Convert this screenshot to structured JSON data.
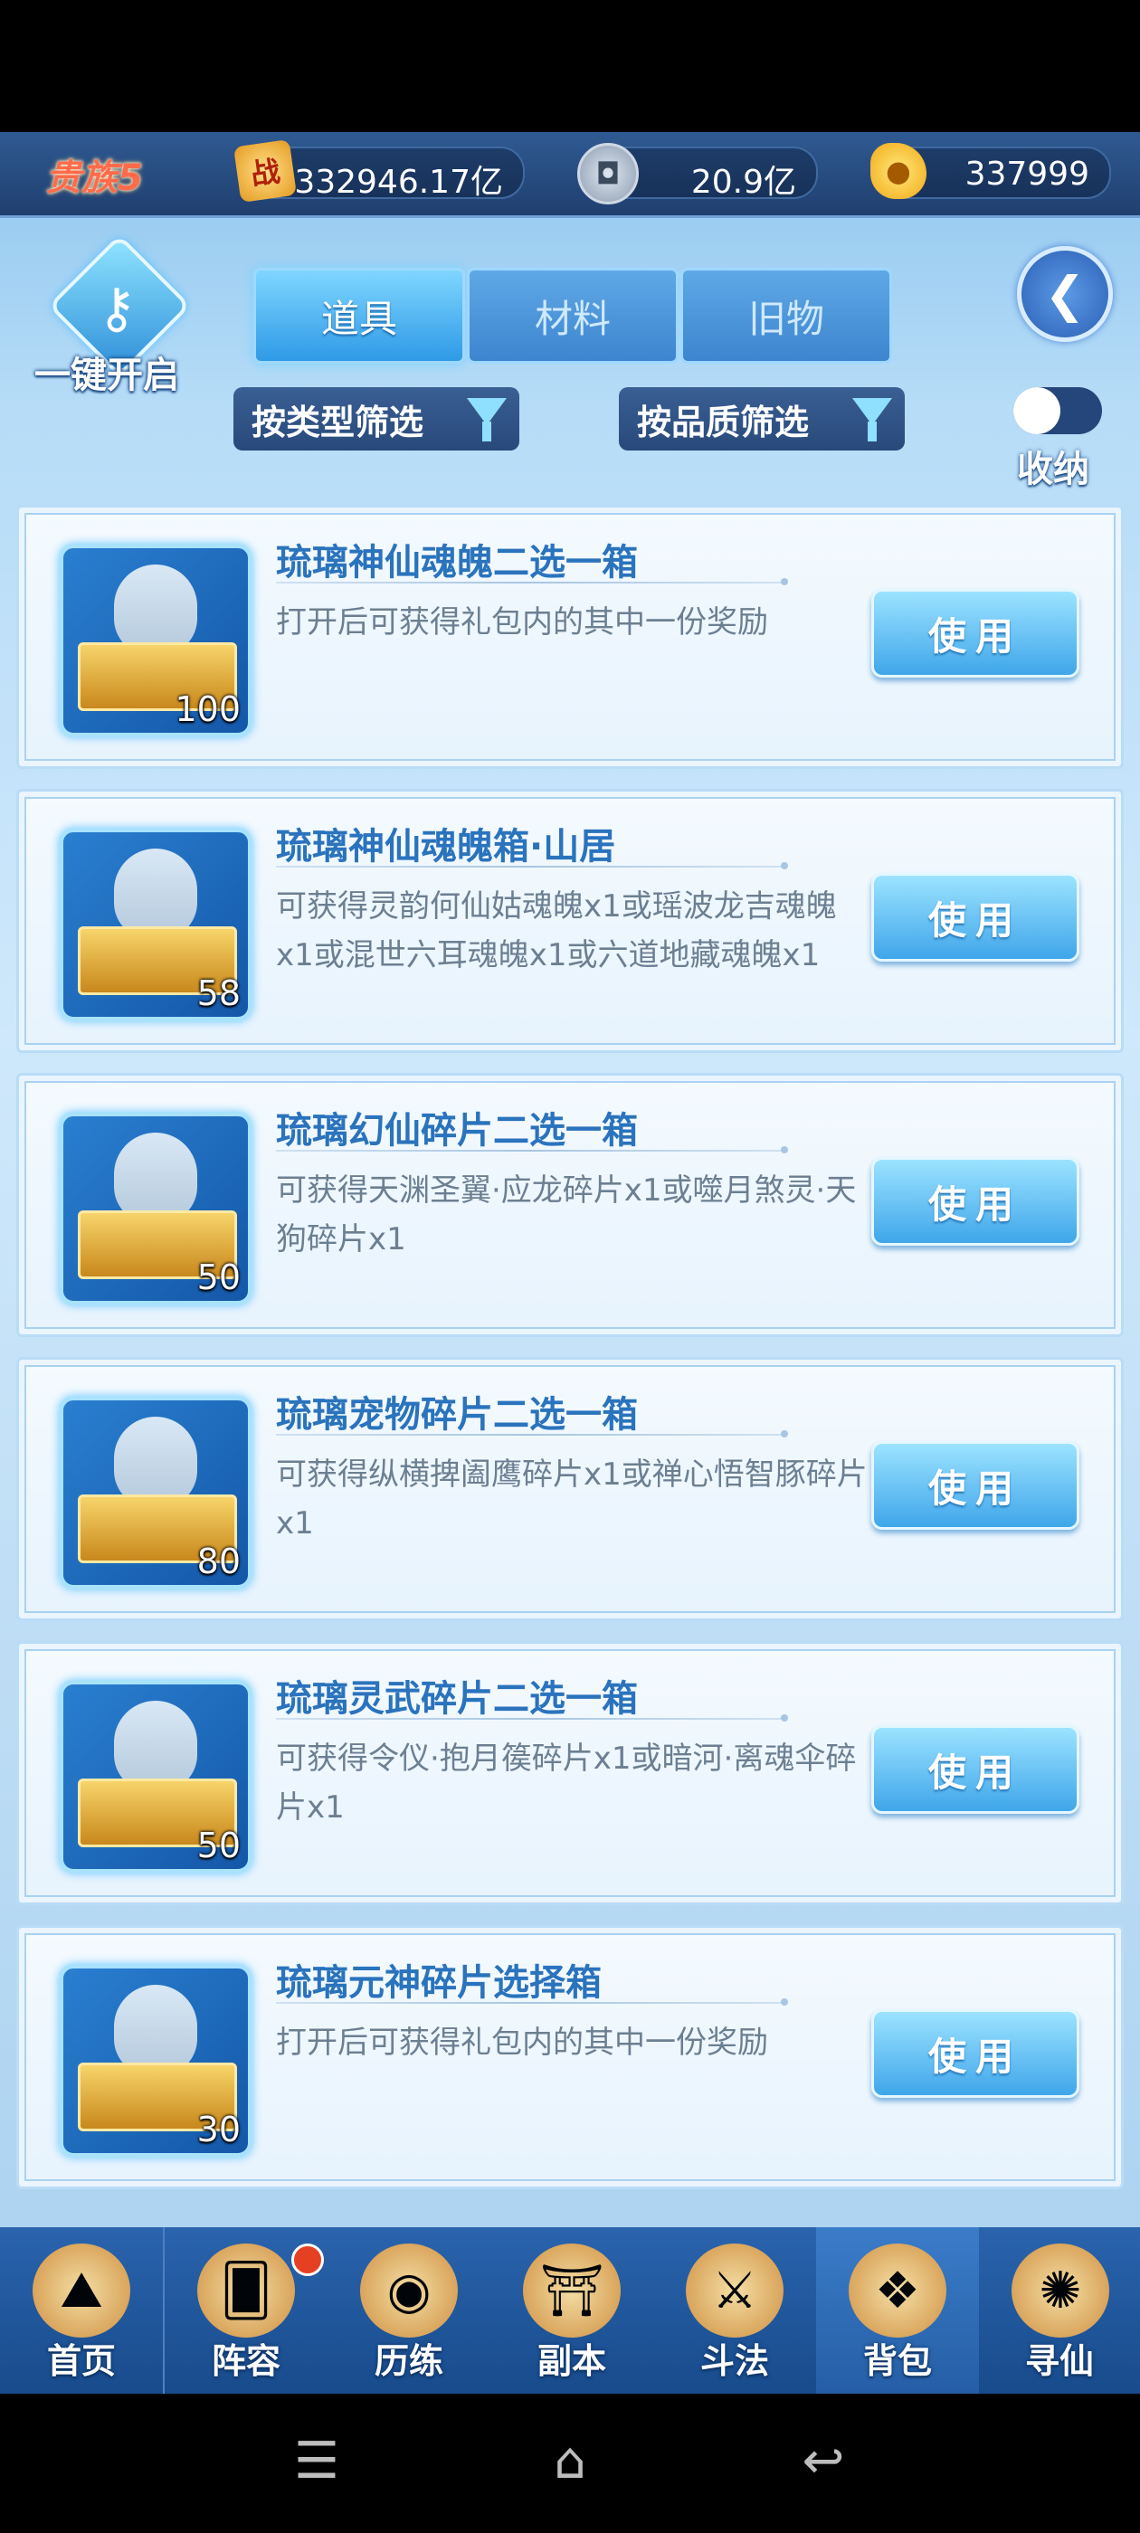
{
  "resources": {
    "rank": "贵族5",
    "zhan_glyph": "战",
    "power": "332946.17亿",
    "silver": "20.9亿",
    "gold": "337999"
  },
  "toolbar": {
    "one_key_label": "一键开启",
    "tabs": [
      "道具",
      "材料",
      "旧物"
    ],
    "active_tab": 0,
    "filter_type": "按类型筛选",
    "filter_quality": "按品质筛选",
    "collapse_label": "收纳"
  },
  "items": [
    {
      "title": "琉璃神仙魂魄二选一箱",
      "desc": "打开后可获得礼包内的其中一份奖励",
      "count": "100",
      "action": "使用"
    },
    {
      "title": "琉璃神仙魂魄箱·山居",
      "desc": "可获得灵韵何仙姑魂魄x1或瑶波龙吉魂魄x1或混世六耳魂魄x1或六道地藏魂魄x1",
      "count": "58",
      "action": "使用"
    },
    {
      "title": "琉璃幻仙碎片二选一箱",
      "desc": "可获得天渊圣翼·应龙碎片x1或噬月煞灵·天狗碎片x1",
      "count": "50",
      "action": "使用"
    },
    {
      "title": "琉璃宠物碎片二选一箱",
      "desc": "可获得纵横捭阖鹰碎片x1或禅心悟智豚碎片x1",
      "count": "80",
      "action": "使用"
    },
    {
      "title": "琉璃灵武碎片二选一箱",
      "desc": "可获得令仪·抱月篌碎片x1或暗河·离魂伞碎片x1",
      "count": "50",
      "action": "使用"
    },
    {
      "title": "琉璃元神碎片选择箱",
      "desc": "打开后可获得礼包内的其中一份奖励",
      "count": "30",
      "action": "使用"
    }
  ],
  "nav": [
    {
      "label": "首页",
      "icon": "home-icon"
    },
    {
      "label": "阵容",
      "icon": "lineup-icon",
      "badge": true
    },
    {
      "label": "历练",
      "icon": "training-icon"
    },
    {
      "label": "副本",
      "icon": "dungeon-icon"
    },
    {
      "label": "斗法",
      "icon": "battle-icon"
    },
    {
      "label": "背包",
      "icon": "bag-icon",
      "active": true
    },
    {
      "label": "寻仙",
      "icon": "seek-icon"
    }
  ]
}
